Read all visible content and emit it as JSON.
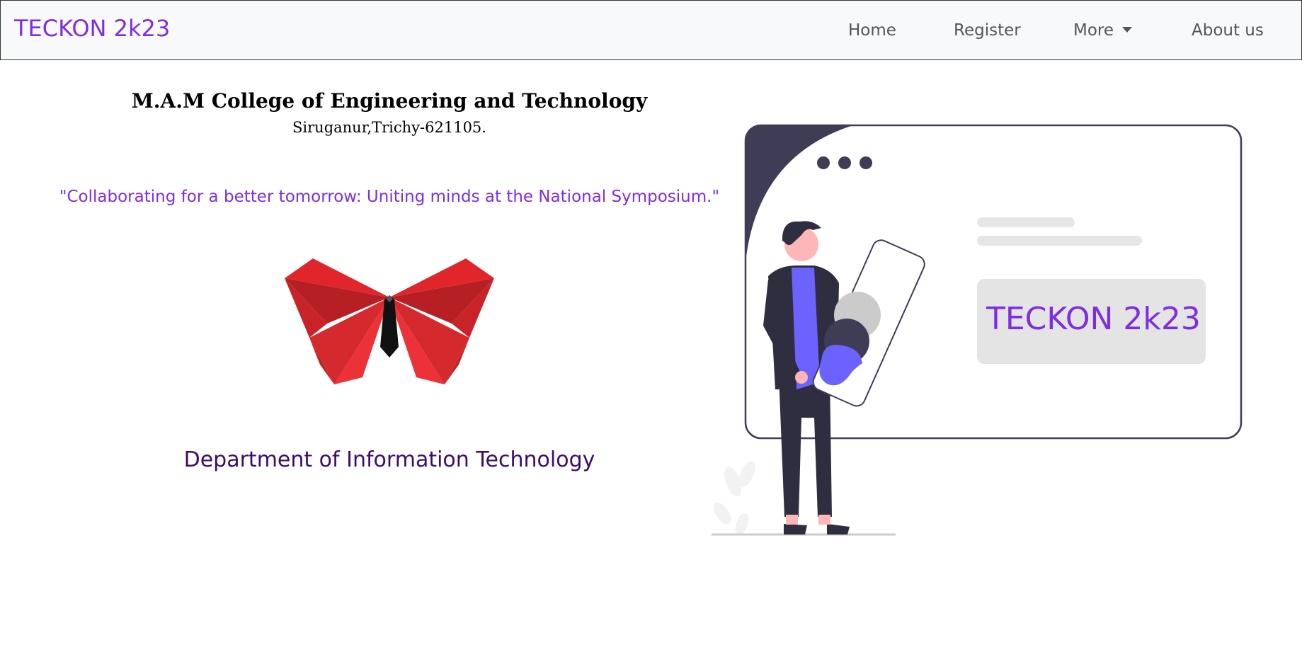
{
  "navbar": {
    "brand": "TECKON 2k23",
    "links": [
      "Home",
      "Register",
      "More",
      "About us"
    ]
  },
  "hero": {
    "college": "M.A.M College of Engineering and Technology",
    "address": "Siruganur,Trichy-621105.",
    "tagline": "\"Collaborating for a better tomorrow: Uniting minds at the National Symposium.\"",
    "department": "Department of Information Technology"
  },
  "illustration": {
    "card_text": "TECKON 2k23"
  },
  "colors": {
    "brand_purple": "#7e2ee0",
    "department_purple": "#3d0d6b",
    "navbar_bg": "#f8f9fa",
    "dark": "#3f3d56",
    "accent": "#6c63ff",
    "butterfly_red": "#e0262b"
  },
  "icons": [
    "butterfly-logo-icon",
    "caret-down-icon",
    "person-illustration"
  ]
}
